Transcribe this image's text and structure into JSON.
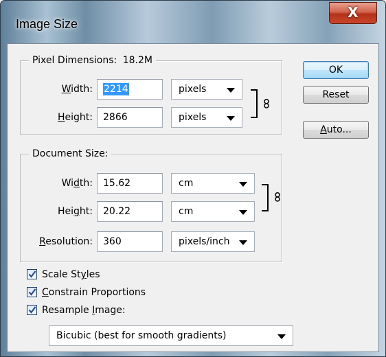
{
  "window": {
    "title": "Image Size",
    "close_label": "X"
  },
  "pixel_dimensions": {
    "legend": "Pixel Dimensions:",
    "size": "18.2M",
    "width": {
      "label_pre": "",
      "label_u": "W",
      "label_post": "idth:",
      "value": "2214",
      "unit": "pixels"
    },
    "height": {
      "label_pre": "",
      "label_u": "H",
      "label_post": "eight:",
      "value": "2866",
      "unit": "pixels"
    }
  },
  "document_size": {
    "legend": "Document Size:",
    "width": {
      "label_pre": "Wi",
      "label_u": "d",
      "label_post": "th:",
      "value": "15.62",
      "unit": "cm"
    },
    "height": {
      "label_pre": "Hei",
      "label_u": "g",
      "label_post": "ht:",
      "value": "20.22",
      "unit": "cm"
    },
    "resolution": {
      "label_pre": "",
      "label_u": "R",
      "label_post": "esolution:",
      "value": "360",
      "unit": "pixels/inch"
    }
  },
  "buttons": {
    "ok": "OK",
    "reset": "Reset",
    "auto_u": "A",
    "auto_rest": "uto..."
  },
  "options": {
    "scale_styles": {
      "pre": "Scale St",
      "u": "y",
      "post": "les",
      "checked": true
    },
    "constrain": {
      "pre": "",
      "u": "C",
      "post": "onstrain Proportions",
      "checked": true
    },
    "resample": {
      "pre": "Resample ",
      "u": "I",
      "post": "mage:",
      "checked": true
    },
    "resample_method": "Bicubic (best for smooth gradients)"
  },
  "icons": {
    "link": "chain-link-icon",
    "check": "checkmark-icon",
    "dropdown": "dropdown-arrow-icon"
  }
}
